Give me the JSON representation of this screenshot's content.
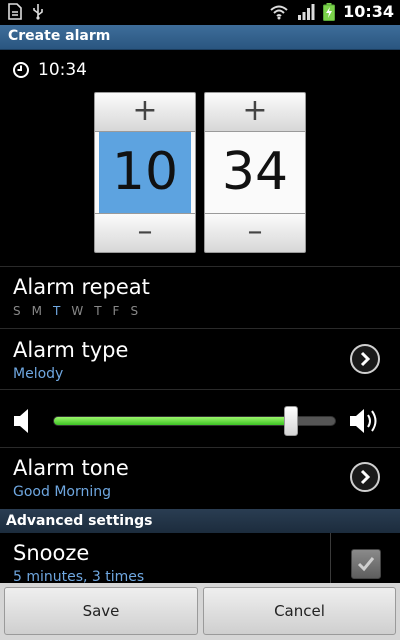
{
  "status_bar": {
    "time": "10:34",
    "icons": [
      "notification-doc-icon",
      "usb-icon",
      "wifi-icon",
      "signal-icon",
      "battery-charging-icon"
    ]
  },
  "title": "Create alarm",
  "alarm_time": "10:34",
  "picker": {
    "plus_label": "+",
    "minus_label": "–",
    "hour": "10",
    "minute": "34"
  },
  "repeat": {
    "title": "Alarm repeat",
    "days": [
      "S",
      "M",
      "T",
      "W",
      "T",
      "F",
      "S"
    ],
    "highlighted_day_index": 2
  },
  "alarm_type": {
    "title": "Alarm type",
    "value": "Melody"
  },
  "volume": {
    "level": 0.84
  },
  "alarm_tone": {
    "title": "Alarm tone",
    "value": "Good Morning"
  },
  "advanced_header": "Advanced settings",
  "snooze": {
    "title": "Snooze",
    "value": "5 minutes, 3 times",
    "checked": true
  },
  "buttons": {
    "save": "Save",
    "cancel": "Cancel"
  },
  "colors": {
    "accent_blue": "#6fa7e0",
    "title_bar": "#2a5680",
    "picker_selection": "#5da3e0",
    "slider_green": "#3cc324"
  }
}
